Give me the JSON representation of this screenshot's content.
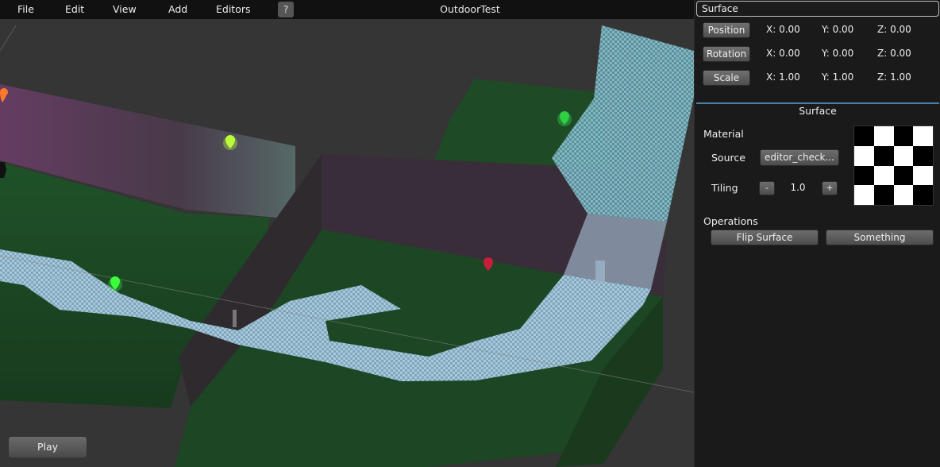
{
  "menu": {
    "items": [
      "File",
      "Edit",
      "View",
      "Add",
      "Editors"
    ],
    "help_label": "?",
    "title": "OutdoorTest"
  },
  "viewport": {
    "play_label": "Play"
  },
  "inspector": {
    "object_name": "Surface",
    "transforms": [
      {
        "label": "Position",
        "x": "X: 0.00",
        "y": "Y: 0.00",
        "z": "Z: 0.00"
      },
      {
        "label": "Rotation",
        "x": "X: 0.00",
        "y": "Y: 0.00",
        "z": "Z: 0.00"
      },
      {
        "label": "Scale",
        "x": "X: 1.00",
        "y": "Y: 1.00",
        "z": "Z: 1.00"
      }
    ],
    "section_title": "Surface",
    "material_label": "Material",
    "source_label": "Source",
    "source_value": "editor_check...",
    "tiling_label": "Tiling",
    "tiling_minus": "-",
    "tiling_value": "1.0",
    "tiling_plus": "+",
    "operations_label": "Operations",
    "operations": [
      "Flip Surface",
      "Something"
    ]
  },
  "colors": {
    "accent": "#4a7fa8",
    "panel_bg": "#1a1a1a",
    "floor_green": "#1e4a26",
    "wall_purple": "#3d2a3d",
    "path_blue": "#8fb2c8"
  }
}
